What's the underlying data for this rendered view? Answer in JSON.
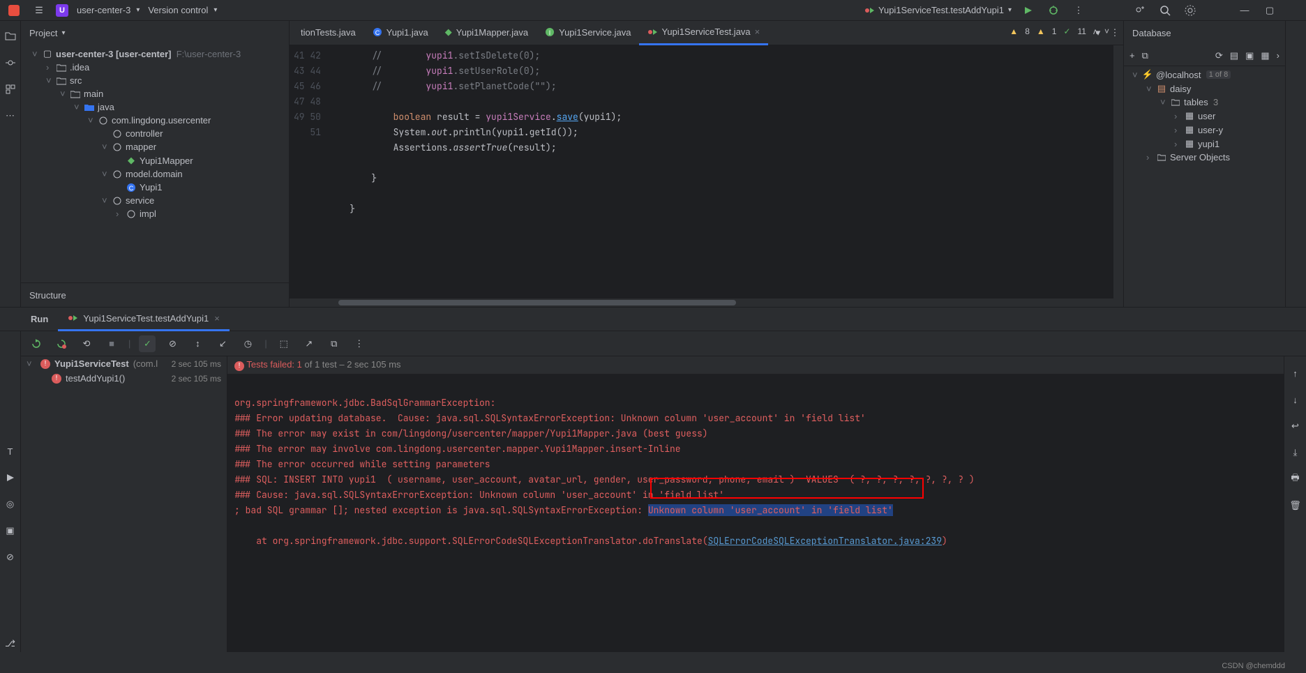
{
  "topbar": {
    "project_letter": "U",
    "project_name": "user-center-3",
    "vcs": "Version control",
    "run_config": "Yupi1ServiceTest.testAddYupi1"
  },
  "projectPanel": {
    "title": "Project"
  },
  "tree": {
    "root": "user-center-3",
    "root_suffix": "[user-center]",
    "root_path": "F:\\user-center-3",
    "idea": ".idea",
    "src": "src",
    "main": "main",
    "java": "java",
    "pkg": "com.lingdong.usercenter",
    "controller": "controller",
    "mapper": "mapper",
    "mapper_file": "Yupi1Mapper",
    "model": "model.domain",
    "yupi1": "Yupi1",
    "service": "service",
    "impl": "impl"
  },
  "structure": {
    "title": "Structure"
  },
  "tabs": [
    {
      "label": "tionTests.java",
      "icon": "none"
    },
    {
      "label": "Yupi1.java",
      "icon": "class"
    },
    {
      "label": "Yupi1Mapper.java",
      "icon": "mapper"
    },
    {
      "label": "Yupi1Service.java",
      "icon": "interface"
    },
    {
      "label": "Yupi1ServiceTest.java",
      "icon": "run",
      "active": true,
      "closable": true
    }
  ],
  "inspections": {
    "w1": "8",
    "w2": "1",
    "ok": "11"
  },
  "code": {
    "start": 41,
    "lines": [
      {
        "n": 41,
        "pre": "        ",
        "html": "<span class='c'>//        </span><span class='f'>yupi1</span><span class='c'>.setIsDelete(0);</span>"
      },
      {
        "n": 42,
        "pre": "        ",
        "html": "<span class='c'>//        </span><span class='f'>yupi1</span><span class='c'>.setUserRole(0);</span>"
      },
      {
        "n": 43,
        "pre": "        ",
        "html": "<span class='c'>//        </span><span class='f'>yupi1</span><span class='c'>.setPlanetCode(\"\");</span>"
      },
      {
        "n": 44,
        "pre": "",
        "html": ""
      },
      {
        "n": 45,
        "pre": "            ",
        "html": "<span class='k'>boolean</span> result = <span class='f'>yupi1Service</span>.<span class='m' style='text-decoration:underline'>save</span>(yupi1);"
      },
      {
        "n": 46,
        "pre": "            ",
        "html": "System.<span class='f it'>out</span>.println(yupi1.getId());"
      },
      {
        "n": 47,
        "pre": "            ",
        "html": "Assertions.<span class='it'>assertTrue</span>(result);"
      },
      {
        "n": 48,
        "pre": "",
        "html": ""
      },
      {
        "n": 49,
        "pre": "        ",
        "html": "}"
      },
      {
        "n": 50,
        "pre": "",
        "html": ""
      },
      {
        "n": 51,
        "pre": "    ",
        "html": "}"
      }
    ]
  },
  "database": {
    "title": "Database",
    "host": "@localhost",
    "host_badge": "1 of 8",
    "schema": "daisy",
    "tables_label": "tables",
    "tables_count": "3",
    "tables": [
      "user",
      "user-y",
      "yupi1"
    ],
    "server_objects": "Server Objects"
  },
  "runPanel": {
    "tab_run": "Run",
    "run_conf": "Yupi1ServiceTest.testAddYupi1"
  },
  "testTree": {
    "root": "Yupi1ServiceTest",
    "root_suffix": "(com.l",
    "root_time": "2 sec 105 ms",
    "child": "testAddYupi1()",
    "child_time": "2 sec 105 ms"
  },
  "testHeader": {
    "prefix": "Tests failed: 1",
    "suffix": " of 1 test – 2 sec 105 ms"
  },
  "console": {
    "l1": "org.springframework.jdbc.BadSqlGrammarException: ",
    "l2": "### Error updating database.  Cause: java.sql.SQLSyntaxErrorException: Unknown column 'user_account' in 'field list'",
    "l3": "### The error may exist in com/lingdong/usercenter/mapper/Yupi1Mapper.java (best guess)",
    "l4": "### The error may involve com.lingdong.usercenter.mapper.Yupi1Mapper.insert-Inline",
    "l5": "### The error occurred while setting parameters",
    "l6": "### SQL: INSERT INTO yupi1  ( username, user_account, avatar_url, gender, user_password, phone, email )  VALUES  ( ?, ?, ?, ?, ?, ?, ? )",
    "l7": "### Cause: java.sql.SQLSyntaxErrorException: Unknown column 'user_account' in 'field list'",
    "l8a": "; bad SQL grammar []; nested exception is java.sql.SQLSyntaxErrorException: ",
    "l8b": "Unknown column 'user_account' in 'field list'",
    "l9a": "    at org.springframework.jdbc.support.SQLErrorCodeSQLExceptionTranslator.doTranslate(",
    "l9b": "SQLErrorCodeSQLExceptionTranslator.java:239",
    "l9c": ")"
  },
  "watermark": "CSDN @chemddd"
}
